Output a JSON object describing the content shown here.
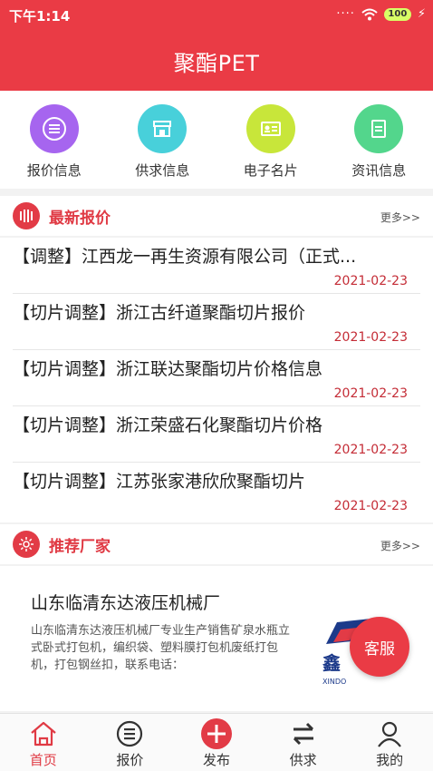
{
  "status": {
    "time": "下午1:14",
    "battery": "100"
  },
  "app": {
    "title": "聚酯PET"
  },
  "quick_nav": [
    {
      "label": "报价信息",
      "color": "#a665ef"
    },
    {
      "label": "供求信息",
      "color": "#48d0da"
    },
    {
      "label": "电子名片",
      "color": "#c8e63a"
    },
    {
      "label": "资讯信息",
      "color": "#53d68c"
    }
  ],
  "price_section": {
    "title": "最新报价",
    "more": "更多>>",
    "items": [
      {
        "title": "【调整】江西龙一再生资源有限公司（正式...",
        "date": "2021-02-23"
      },
      {
        "title": "【切片调整】浙江古纤道聚酯切片报价",
        "date": "2021-02-23"
      },
      {
        "title": "【切片调整】浙江联达聚酯切片价格信息",
        "date": "2021-02-23"
      },
      {
        "title": "【切片调整】浙江荣盛石化聚酯切片价格",
        "date": "2021-02-23"
      },
      {
        "title": "【切片调整】江苏张家港欣欣聚酯切片",
        "date": "2021-02-23"
      }
    ]
  },
  "factory_section": {
    "title": "推荐厂家",
    "more": "更多>>",
    "name": "山东临清东达液压机械厂",
    "description": "山东临清东达液压机械厂专业生产销售矿泉水瓶立式卧式打包机，编织袋、塑料膜打包机废纸打包机，打包钢丝扣，联系电话：",
    "logo_text": "鑫",
    "logo_sub": "XINDO"
  },
  "service_button": "客服",
  "tabbar": [
    {
      "label": "首页",
      "active": true
    },
    {
      "label": "报价",
      "active": false
    },
    {
      "label": "发布",
      "active": false
    },
    {
      "label": "供求",
      "active": false
    },
    {
      "label": "我的",
      "active": false
    }
  ],
  "colors": {
    "brand": "#ea3b45",
    "date": "#c42c36"
  }
}
